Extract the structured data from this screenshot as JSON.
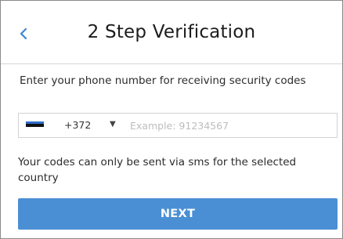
{
  "header": {
    "title": "2 Step Verification",
    "back_icon": "chevron-left-icon"
  },
  "form": {
    "instruction": "Enter your phone number for receiving security codes",
    "country": {
      "flag": "estonia-flag-icon",
      "dial_code": "+372",
      "caret_icon": "caret-down-icon"
    },
    "phone_placeholder": "Example: 91234567",
    "phone_value": "",
    "note": "Your codes can only be sent via sms for the selected country"
  },
  "actions": {
    "next_label": "NEXT"
  },
  "colors": {
    "accent": "#4a8fd4",
    "back_arrow": "#3a86d6"
  }
}
